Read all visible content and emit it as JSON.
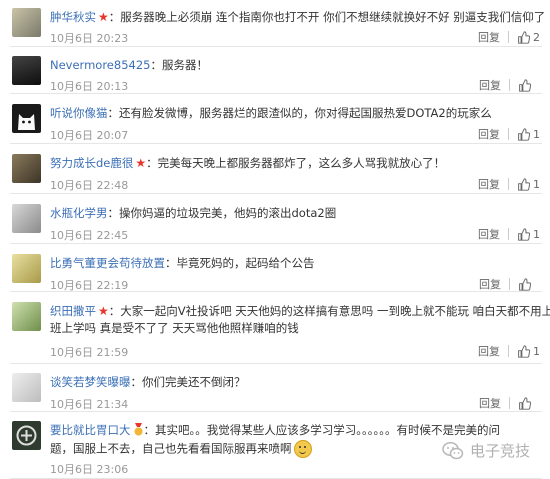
{
  "comments": [
    {
      "name": "肿华秋实",
      "star": true,
      "text": "服务器晚上必须崩 连个指南你也打不开 你们不想继续就换好不好 别逼支我们信仰了",
      "time": "10月6日 20:23",
      "reply": "回复",
      "likes": "2"
    },
    {
      "name": "Nevermore85425",
      "star": false,
      "text": "服务器！",
      "time": "10月6日 20:13",
      "reply": "回复",
      "likes": ""
    },
    {
      "name": "听说你像猫",
      "star": false,
      "text": "还有脸发微博，服务器烂的跟渣似的，你对得起国服热爱DOTA2的玩家么",
      "time": "10月6日 20:07",
      "reply": "回复",
      "likes": "1"
    },
    {
      "name": "努力成长de鹿很",
      "star": true,
      "text": "完美每天晚上都服务器都炸了，这么多人骂我就放心了！",
      "time": "10月6日 22:48",
      "reply": "回复",
      "likes": "1"
    },
    {
      "name": "水瓶化学男",
      "star": false,
      "text": "操你妈逼的垃圾完美，他妈的滚出dota2圈",
      "time": "10月6日 22:45",
      "reply": "回复",
      "likes": "1"
    },
    {
      "name": "比勇气董更会苟待放置",
      "star": false,
      "text": "毕竟死妈的，起码给个公告",
      "time": "10月6日 22:19",
      "reply": "回复",
      "likes": ""
    },
    {
      "name": "织田撒平",
      "star": true,
      "text": "大家一起向V社投诉吧 天天他妈的这样搞有意思吗 一到晚上就不能玩 咱白天都不用上",
      "text2": "班上学吗 真是受不了了 天天骂他他照样赚咱的钱",
      "time": "10月6日 21:59",
      "reply": "回复",
      "likes": "1"
    },
    {
      "name": "谈笑若梦笑曝曝",
      "star": false,
      "text": "你们完美还不倒闭？",
      "time": "10月6日 21:34",
      "reply": "回复",
      "likes": ""
    },
    {
      "name": "要比就比胃口大",
      "star": false,
      "text": "其实吧。。我觉得某些人应该多学习学习。。。。。。有时候不是完美的问",
      "text2": "题，国服上不去，自己也先看看国际服再来喷啊",
      "time": "10月6日 23:06",
      "reply": "回复",
      "likes": ""
    }
  ],
  "watermark": {
    "text": "电子竞技"
  },
  "icons": {
    "like": "thumb-up-icon",
    "star": "star-icon",
    "badge": "medal-icon",
    "watermark": "wechat-logo-icon"
  },
  "colors": {
    "name": "#3b6fb6",
    "star": "#e8352b",
    "time": "#999999"
  }
}
